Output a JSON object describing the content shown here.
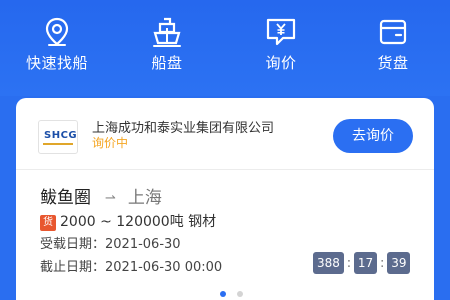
{
  "nav": {
    "items": [
      {
        "label": "快速找船",
        "icon": "map-pin-icon"
      },
      {
        "label": "船盘",
        "icon": "ship-icon"
      },
      {
        "label": "询价",
        "icon": "yen-message-icon"
      },
      {
        "label": "货盘",
        "icon": "wallet-icon"
      }
    ]
  },
  "card": {
    "logo_text": "SHCG",
    "company_name": "上海成功和泰实业集团有限公司",
    "inquiry_status": "询价中",
    "inquiry_button": "去询价",
    "route_from": "鲅鱼圈",
    "route_to": "上海",
    "cargo_badge": "货",
    "cargo_text": "2000 ~ 120000吨 钢材",
    "load_date_label": "受载日期：",
    "load_date": "2021-06-30",
    "deadline_label": "截止日期：",
    "deadline": "2021-06-30 00:00",
    "countdown": {
      "hours": "388",
      "minutes": "17",
      "seconds": "39"
    }
  },
  "colors": {
    "brand_blue": "#2b6ff2",
    "status_orange": "#f5a623",
    "badge_red": "#e8572f",
    "countdown_bg": "#5c6b8e"
  },
  "carousel": {
    "active_index": 1,
    "total": 2
  }
}
